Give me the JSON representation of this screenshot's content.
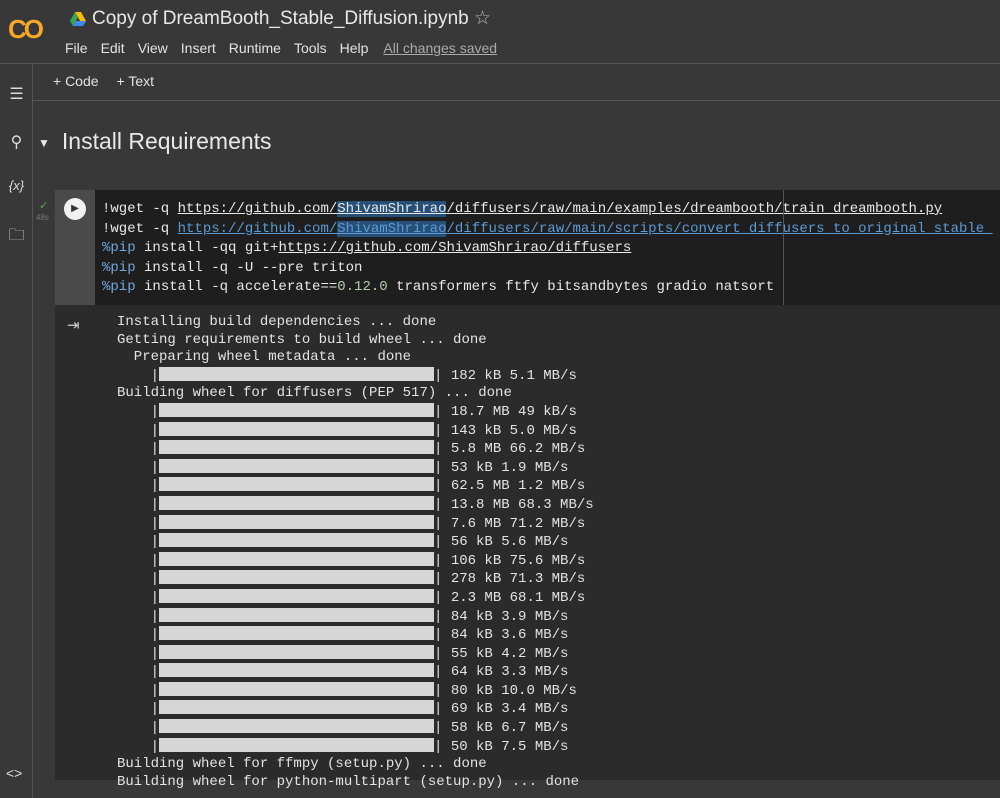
{
  "header": {
    "logo": "CO",
    "title": "Copy of DreamBooth_Stable_Diffusion.ipynb",
    "menu": [
      "File",
      "Edit",
      "View",
      "Insert",
      "Runtime",
      "Tools",
      "Help"
    ],
    "save_status": "All changes saved"
  },
  "toolbar": {
    "code": "+ Code",
    "text": "+ Text"
  },
  "section": {
    "title": "Install Requirements"
  },
  "cell": {
    "exec_time": "48s",
    "lines": [
      [
        "!wget -q ",
        "https://github.com/",
        "ShivamShrirao",
        "/diffusers/raw/main/examples/dreambooth/train_dreambooth.py"
      ],
      [
        "!wget -q ",
        "https://github.com/",
        "ShivamShrirao",
        "/diffusers/raw/main/scripts/convert_diffusers_to_original_stable_"
      ],
      [
        "%pip",
        " install -qq git+",
        "https://github.com/ShivamShrirao/diffusers"
      ],
      [
        "%pip",
        " install -q -U --pre triton"
      ],
      [
        "%pip",
        " install -q accelerate==",
        "0.12.0",
        " transformers ftfy bitsandbytes gradio natsort"
      ]
    ]
  },
  "output": {
    "head": [
      "Installing build dependencies ... done",
      "Getting requirements to build wheel ... done",
      "  Preparing wheel metadata ... done"
    ],
    "first_bar": "182 kB 5.1 MB/s",
    "building": "Building wheel for diffusers (PEP 517) ... done",
    "bars": [
      "18.7 MB 49 kB/s",
      "143 kB 5.0 MB/s",
      "5.8 MB 66.2 MB/s",
      "53 kB 1.9 MB/s",
      "62.5 MB 1.2 MB/s",
      "13.8 MB 68.3 MB/s",
      "7.6 MB 71.2 MB/s",
      "56 kB 5.6 MB/s",
      "106 kB 75.6 MB/s",
      "278 kB 71.3 MB/s",
      "2.3 MB 68.1 MB/s",
      "84 kB 3.9 MB/s",
      "84 kB 3.6 MB/s",
      "55 kB 4.2 MB/s",
      "64 kB 3.3 MB/s",
      "80 kB 10.0 MB/s",
      "69 kB 3.4 MB/s",
      "58 kB 6.7 MB/s",
      "50 kB 7.5 MB/s"
    ],
    "tail": [
      "Building wheel for ffmpy (setup.py) ... done",
      "Building wheel for python-multipart (setup.py) ... done"
    ]
  }
}
